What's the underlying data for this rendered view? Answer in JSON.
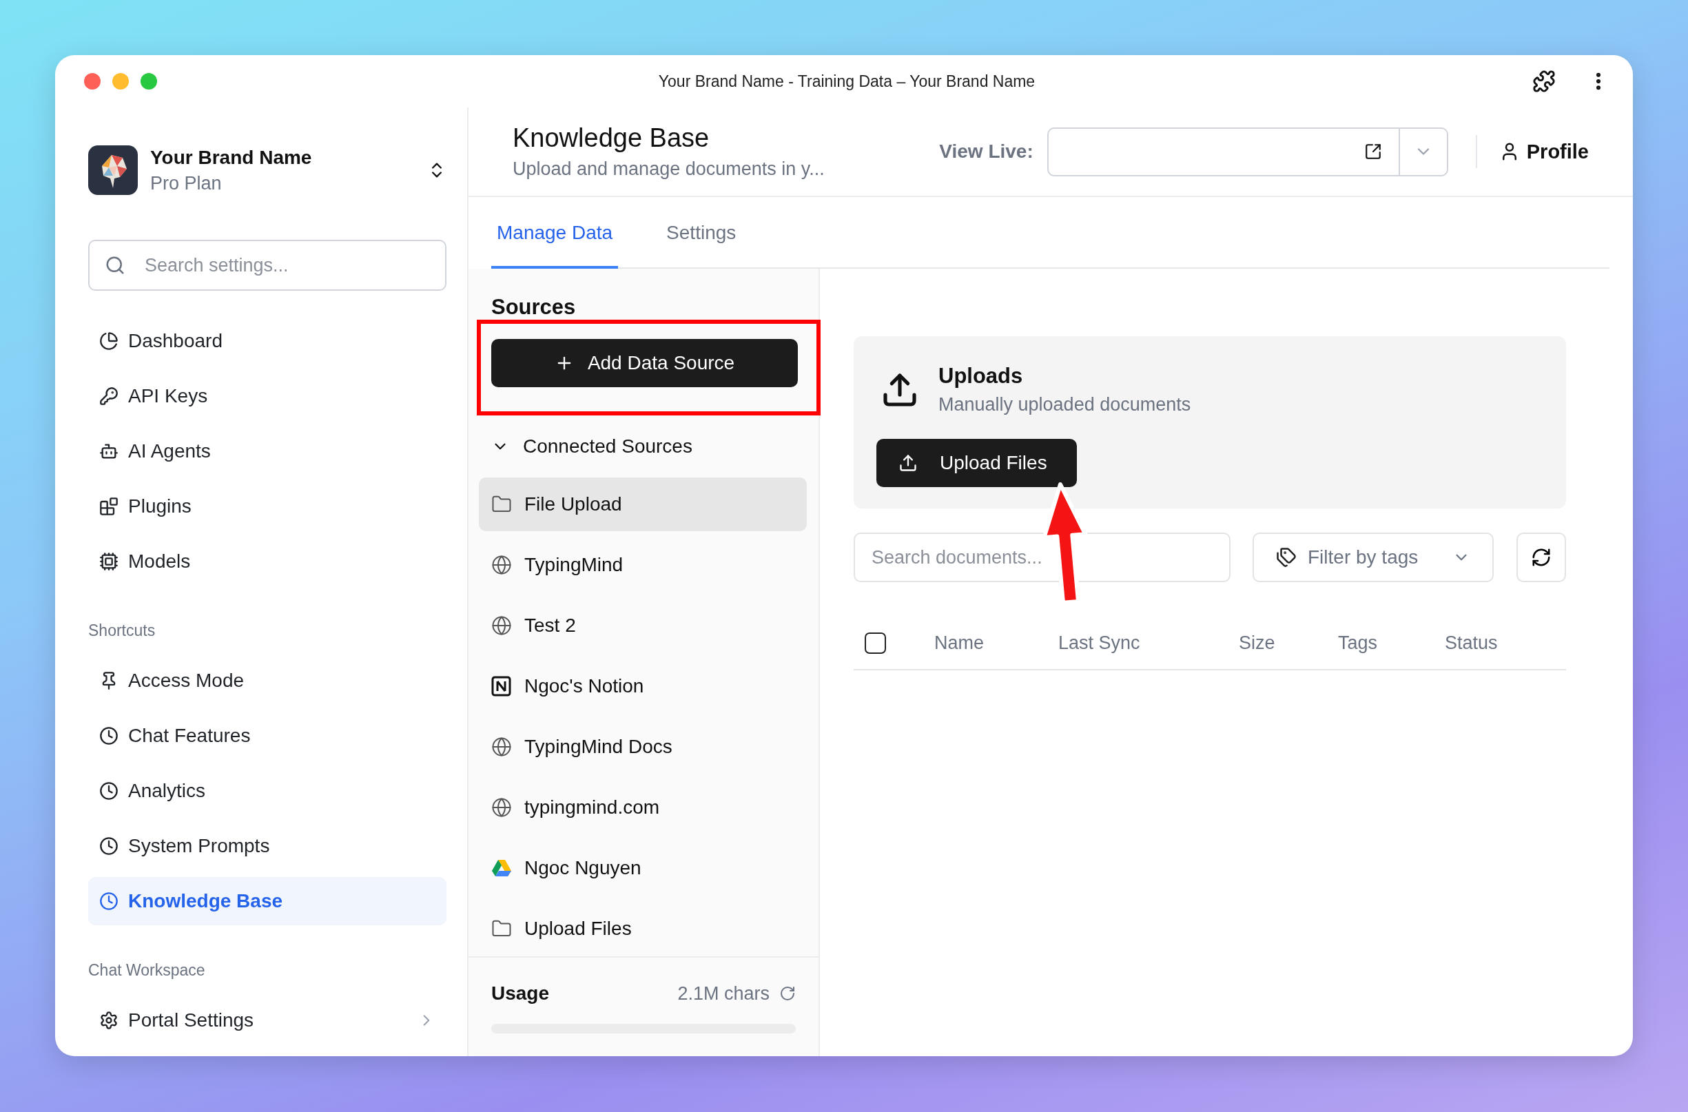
{
  "window": {
    "title": "Your Brand Name - Training Data – Your Brand Name"
  },
  "brand": {
    "name": "Your Brand Name",
    "plan": "Pro Plan"
  },
  "sidebar": {
    "search": {
      "placeholder": "Search settings..."
    },
    "items": [
      {
        "label": "Dashboard",
        "selected": false
      },
      {
        "label": "API Keys",
        "selected": false
      },
      {
        "label": "AI Agents",
        "selected": false
      },
      {
        "label": "Plugins",
        "selected": false
      },
      {
        "label": "Models",
        "selected": false
      }
    ],
    "sections": [
      {
        "heading": "Shortcuts",
        "items": [
          {
            "label": "Access Mode",
            "selected": false
          },
          {
            "label": "Chat Features",
            "selected": false
          },
          {
            "label": "Analytics",
            "selected": false
          },
          {
            "label": "System Prompts",
            "selected": false
          },
          {
            "label": "Knowledge Base",
            "selected": true
          }
        ]
      },
      {
        "heading": "Chat Workspace",
        "items": [
          {
            "label": "Portal Settings",
            "selected": false
          }
        ]
      }
    ]
  },
  "header": {
    "title": "Knowledge Base",
    "subtitle": "Upload and manage documents in y...",
    "view_live": {
      "label": "View Live:"
    },
    "profile": "Profile"
  },
  "tabs": [
    {
      "label": "Manage Data",
      "selected": true
    },
    {
      "label": "Settings",
      "selected": false
    }
  ],
  "sources": {
    "heading": "Sources",
    "add_button": "Add Data Source",
    "group": {
      "label": "Connected Sources",
      "expanded": true,
      "items": [
        {
          "label": "File Upload",
          "kind": "folder",
          "selected": true
        },
        {
          "label": "TypingMind",
          "kind": "web",
          "selected": false
        },
        {
          "label": "Test 2",
          "kind": "web",
          "selected": false
        },
        {
          "label": "Ngoc's Notion",
          "kind": "notion",
          "selected": false
        },
        {
          "label": "TypingMind Docs",
          "kind": "web",
          "selected": false
        },
        {
          "label": "typingmind.com",
          "kind": "web",
          "selected": false
        },
        {
          "label": "Ngoc Nguyen",
          "kind": "drive",
          "selected": false
        },
        {
          "label": "Upload Files",
          "kind": "folder",
          "selected": false
        }
      ]
    },
    "usage": {
      "label": "Usage",
      "value": "2.1M chars",
      "level": 0
    }
  },
  "uploads": {
    "title": "Uploads",
    "subtitle": "Manually uploaded documents",
    "button": "Upload Files"
  },
  "documents": {
    "search": {
      "placeholder": "Search documents..."
    },
    "filter": "Filter by tags",
    "table": {
      "select_all": {
        "checked": false
      },
      "columns": [
        "Name",
        "Last Sync",
        "Size",
        "Tags",
        "Status"
      ]
    }
  }
}
